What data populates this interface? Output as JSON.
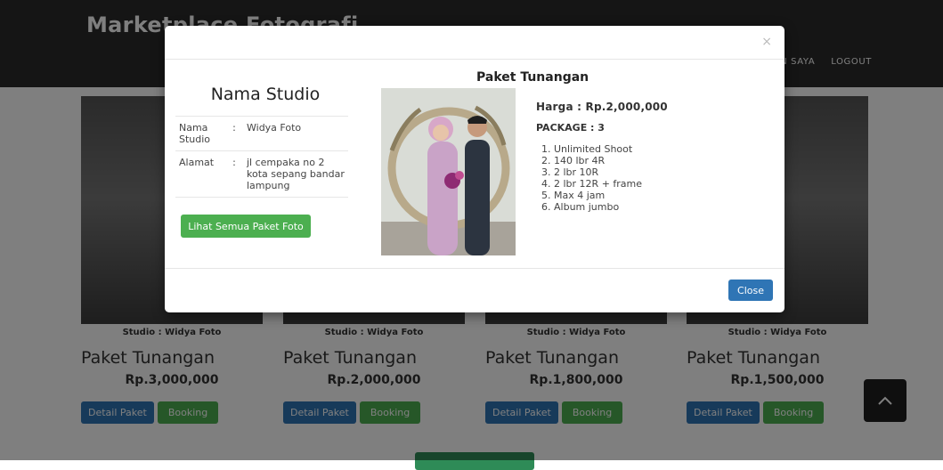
{
  "header": {
    "brand": "Marketplace Fotografi",
    "nav": [
      "N SAYA",
      "LOGOUT"
    ]
  },
  "cards": [
    {
      "studio": "Studio : Widya Foto",
      "title": "Paket Tunangan",
      "price": "Rp.3,000,000",
      "detail_label": "Detail Paket",
      "booking_label": "Booking"
    },
    {
      "studio": "Studio : Widya Foto",
      "title": "Paket Tunangan",
      "price": "Rp.2,000,000",
      "detail_label": "Detail Paket",
      "booking_label": "Booking"
    },
    {
      "studio": "Studio : Widya Foto",
      "title": "Paket Tunangan",
      "price": "Rp.1,800,000",
      "detail_label": "Detail Paket",
      "booking_label": "Booking"
    },
    {
      "studio": "Studio : Widya Foto",
      "title": "Paket Tunangan",
      "price": "Rp.1,500,000",
      "detail_label": "Detail Paket",
      "booking_label": "Booking"
    }
  ],
  "modal": {
    "close_x": "×",
    "studio_title": "Nama Studio",
    "name_label": "Nama Studio",
    "name_value": "Widya Foto",
    "address_label": "Alamat",
    "address_value": "jl cempaka no 2 kota sepang bandar lampung",
    "separator": ":",
    "all_packages_button": "Lihat Semua Paket Foto",
    "package_title": "Paket Tunangan",
    "price_text": "Harga : Rp.2,000,000",
    "package_text": "PACKAGE : 3",
    "items": [
      "Unlimited Shoot",
      "140 lbr 4R",
      "2 lbr 10R",
      "2 lbr 12R  + frame",
      "Max 4 jam",
      "Album jumbo"
    ],
    "close_button": "Close"
  }
}
